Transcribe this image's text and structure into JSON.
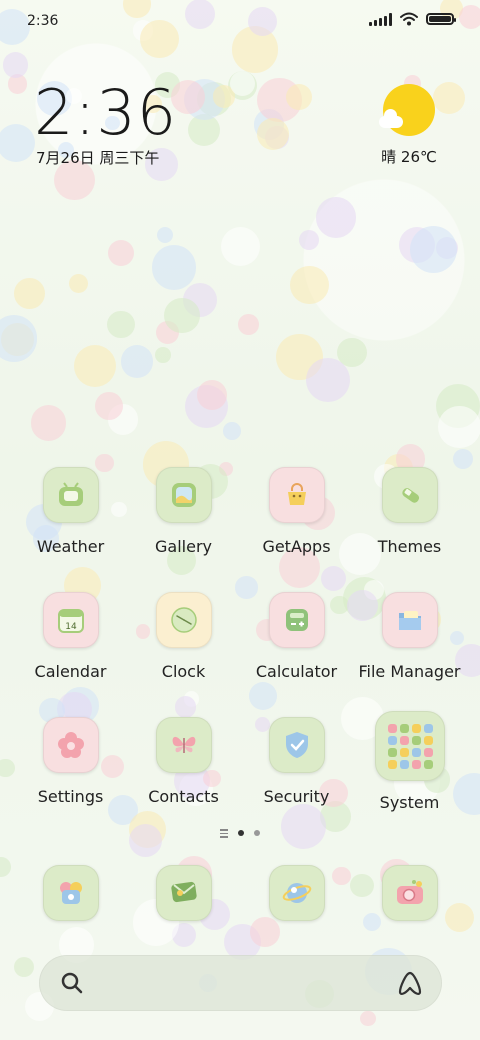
{
  "status_bar": {
    "time": "2:36"
  },
  "clock_widget": {
    "time": "2:36",
    "date": "7月26日 周三下午"
  },
  "weather_widget": {
    "text": "晴 26℃",
    "icon": "sun-cloud-icon"
  },
  "apps": [
    {
      "label": "Weather",
      "icon": "weather-icon"
    },
    {
      "label": "Gallery",
      "icon": "gallery-icon"
    },
    {
      "label": "GetApps",
      "icon": "shopping-bag-icon"
    },
    {
      "label": "Themes",
      "icon": "brush-icon"
    },
    {
      "label": "Calendar",
      "icon": "calendar-icon",
      "badge": "14"
    },
    {
      "label": "Clock",
      "icon": "clock-icon"
    },
    {
      "label": "Calculator",
      "icon": "calculator-icon"
    },
    {
      "label": "File Manager",
      "icon": "folder-icon"
    },
    {
      "label": "Settings",
      "icon": "flower-gear-icon"
    },
    {
      "label": "Contacts",
      "icon": "butterfly-icon"
    },
    {
      "label": "Security",
      "icon": "shield-icon"
    },
    {
      "label": "System",
      "icon": "folder-grid-icon"
    }
  ],
  "page_indicator": {
    "pages": 2,
    "active": 1
  },
  "dock": [
    {
      "icon": "phone-icon"
    },
    {
      "icon": "messages-icon"
    },
    {
      "icon": "browser-icon"
    },
    {
      "icon": "camera-icon"
    }
  ],
  "search_bar": {
    "left_icon": "search-icon",
    "right_icon": "assistant-icon"
  }
}
